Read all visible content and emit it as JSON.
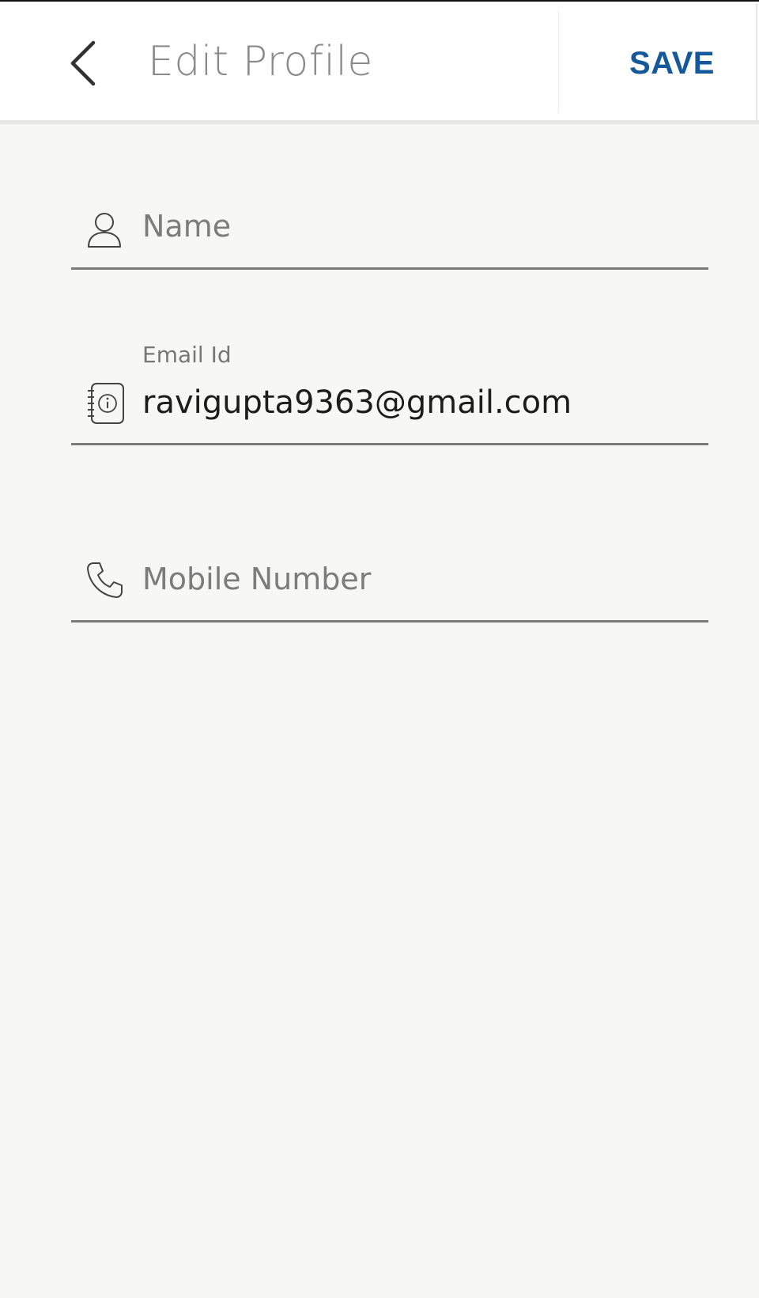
{
  "header": {
    "title": "Edit Profile",
    "save_label": "SAVE",
    "back_icon": "chevron-left-icon"
  },
  "form": {
    "name": {
      "icon": "person-icon",
      "value": "",
      "placeholder": "Name"
    },
    "email": {
      "icon": "contact-book-icon",
      "label": "Email Id",
      "value": "ravigupta9363@gmail.com"
    },
    "mobile": {
      "icon": "phone-icon",
      "value": "",
      "placeholder": "Mobile Number"
    }
  },
  "colors": {
    "accent": "#15599b",
    "background": "#f7f7f5",
    "header_background": "#ffffff",
    "title": "#8a8a8a",
    "underline": "#7a7a7a"
  }
}
